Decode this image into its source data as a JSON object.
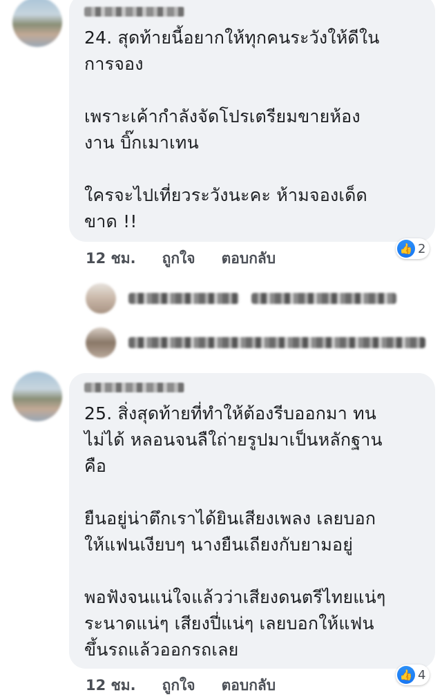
{
  "comments": [
    {
      "number_text": "24. สุดท้ายนี้อยากให้ทุกคนระวังให้ดีใน\nการจอง\n\nเพราะเค้ากำลังจัดโปรเตรียมขายห้อง\nงาน บิ๊กเมาเทน\n\nใครจะไปเที่ยวระวังนะคะ ห้ามจองเด็ด\nขาด !!",
      "time": "12 ชม.",
      "like_label": "ถูกใจ",
      "reply_label": "ตอบกลับ",
      "reaction_count": "2"
    },
    {
      "number_text": "25. สิ่งสุดท้ายที่ทำให้ต้องรีบออกมา ทน\nไม่ได้ หลอนจนลืใถ่ายรูปมาเป็นหลักฐาน\nคือ\n\n ยืนอยู่น่าตึกเราได้ยินเสียงเพลง เลยบอก\nให้แฟนเงียบๆ นางยืนเถียงกับยามอยู่\n\nพอฟังจนแน่ใจแล้วว่าเสียงดนตรีไทยแน่ๆ\nระนาดแน่ๆ เสียงปี่แน่ๆ เลยบอกให้แฟน\nขึ้นรถแล้วออกรถเลย",
      "time": "12 ชม.",
      "like_label": "ถูกใจ",
      "reply_label": "ตอบกลับ",
      "reaction_count": "4"
    }
  ],
  "icons": {
    "reaction": "like-thumb-icon",
    "accent": "#1877f2"
  }
}
